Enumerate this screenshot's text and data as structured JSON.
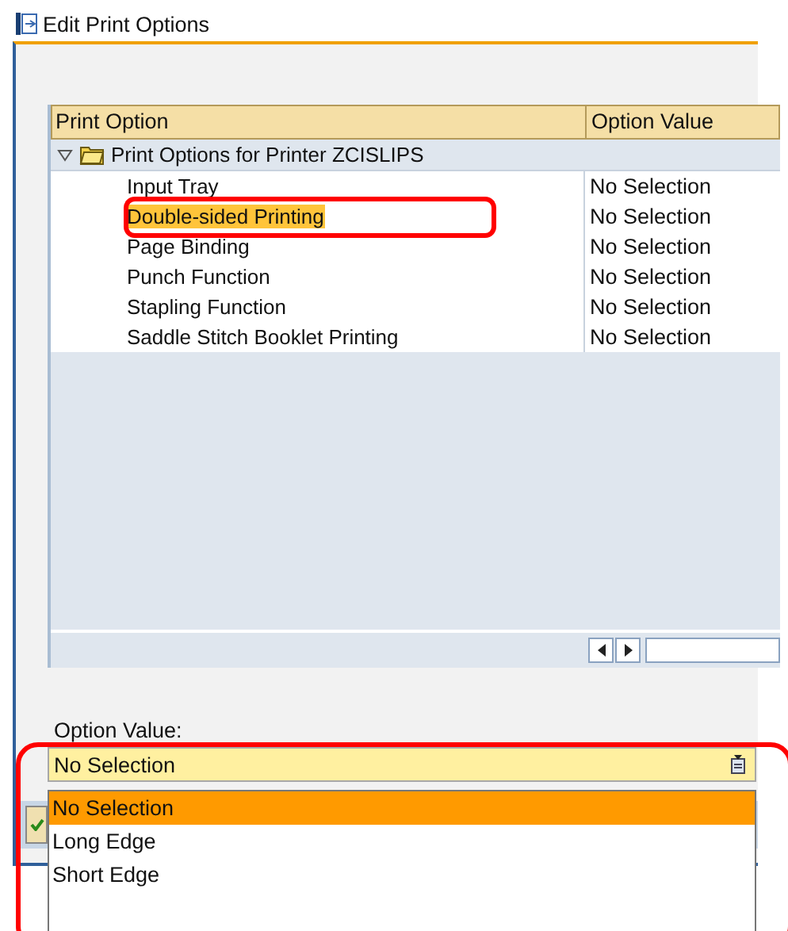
{
  "window": {
    "title": "Edit Print Options"
  },
  "table": {
    "columns": [
      "Print Option",
      "Option Value"
    ],
    "root": {
      "label": "Print Options for Printer ZCISLIPS",
      "expanded": true,
      "children": [
        {
          "option": "Input Tray",
          "value": "No Selection",
          "selected": false
        },
        {
          "option": "Double-sided Printing",
          "value": "No Selection",
          "selected": true
        },
        {
          "option": "Page Binding",
          "value": "No Selection",
          "selected": false
        },
        {
          "option": "Punch Function",
          "value": "No Selection",
          "selected": false
        },
        {
          "option": "Stapling Function",
          "value": "No Selection",
          "selected": false
        },
        {
          "option": "Saddle Stitch Booklet Printing",
          "value": "No Selection",
          "selected": false
        }
      ]
    }
  },
  "option_value": {
    "label": "Option Value:",
    "value": "No Selection",
    "options": [
      {
        "label": "No Selection",
        "selected": true
      },
      {
        "label": "Long Edge",
        "selected": false
      },
      {
        "label": "Short Edge",
        "selected": false
      }
    ]
  }
}
